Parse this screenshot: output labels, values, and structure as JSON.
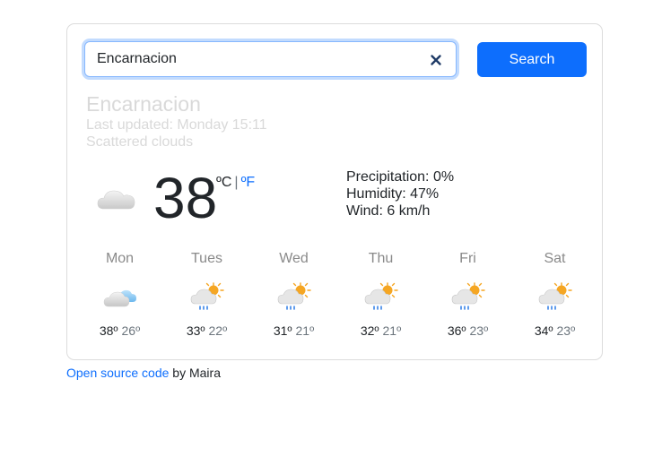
{
  "search": {
    "value": "Encarnacion",
    "button_label": "Search"
  },
  "current": {
    "city": "Encarnacion",
    "last_updated": "Last updated: Monday 15:11",
    "description": "Scattered clouds",
    "icon": "scattered-clouds-icon",
    "temperature": "38",
    "unit_celsius": "ºC",
    "unit_separator": "|",
    "unit_fahrenheit": "ºF",
    "precipitation": "Precipitation: 0%",
    "humidity": "Humidity: 47%",
    "wind": "Wind: 6 km/h"
  },
  "forecast": [
    {
      "day": "Mon",
      "max": "38º",
      "min": "26º",
      "icon": "cloud-sun-blue-icon"
    },
    {
      "day": "Tues",
      "max": "33º",
      "min": "22º",
      "icon": "rain-sun-icon"
    },
    {
      "day": "Wed",
      "max": "31º",
      "min": "21º",
      "icon": "rain-sun-icon"
    },
    {
      "day": "Thu",
      "max": "32º",
      "min": "21º",
      "icon": "rain-sun-icon"
    },
    {
      "day": "Fri",
      "max": "36º",
      "min": "23º",
      "icon": "rain-sun-icon"
    },
    {
      "day": "Sat",
      "max": "34º",
      "min": "23º",
      "icon": "rain-sun-icon"
    }
  ],
  "footer": {
    "link_text": "Open source code",
    "suffix": " by Maira"
  },
  "colors": {
    "accent": "#0d6efd",
    "muted_heading": "#d9d9d9",
    "sun": "#f5a623",
    "rain": "#2c7be5"
  }
}
